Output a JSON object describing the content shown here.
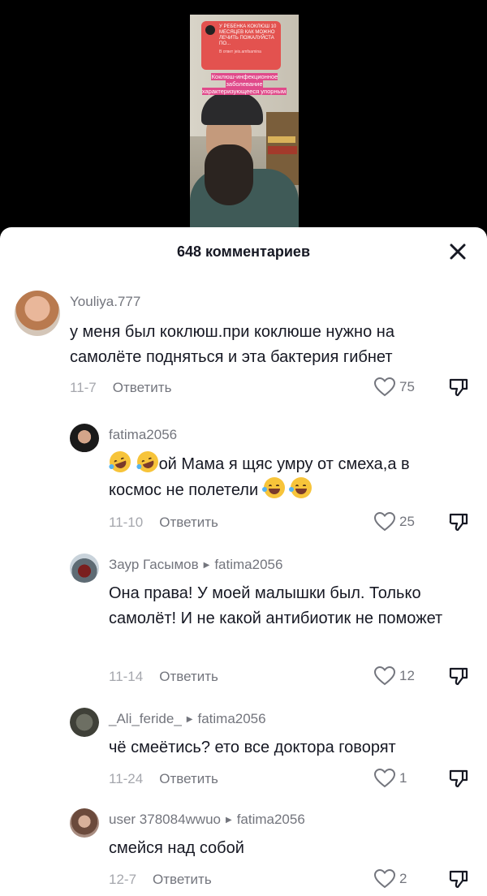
{
  "video": {
    "card_text": "У РЕБЕНКА КОКЛЮШ 10 МЕСЯЦЕВ КАК МОЖНО ЛЕЧИТЬ ПОЖАЛУЙСТА ПО...",
    "card_sub": "В ответ jeis.amfsamina",
    "caption": "Коклюш-инфекционное заболевание характеризующееся упорным"
  },
  "sheet": {
    "title": "648 комментариев"
  },
  "comments": [
    {
      "username": "Youliya.777",
      "text": "у меня был коклюш.при коклюше нужно на самолёте подняться и эта бактерия гибнет",
      "date": "11-7",
      "reply_label": "Ответить",
      "likes": "75"
    },
    {
      "username": "fatima2056",
      "text_after_emoji": "ой Мама я щяс умру от смеха,а в космос не полетели",
      "date": "11-10",
      "reply_label": "Ответить",
      "likes": "25"
    },
    {
      "username": "Заур Гасымов",
      "reply_to": "fatima2056",
      "text": "Она права! У моей малышки был. Только самолёт! И не какой антибиотик не поможет",
      "date": "11-14",
      "reply_label": "Ответить",
      "likes": "12"
    },
    {
      "username": "_Ali_feride_",
      "reply_to": "fatima2056",
      "text": "чё смеётись? ето все доктора говорят",
      "date": "11-24",
      "reply_label": "Ответить",
      "likes": "1"
    },
    {
      "username": "user 378084wwuo",
      "reply_to": "fatima2056",
      "text": "смейся над собой",
      "date": "12-7",
      "reply_label": "Ответить",
      "likes": "2"
    }
  ],
  "colors": {
    "text_primary": "#161823",
    "text_secondary": "#73757d",
    "text_date": "#a5a7ad"
  }
}
